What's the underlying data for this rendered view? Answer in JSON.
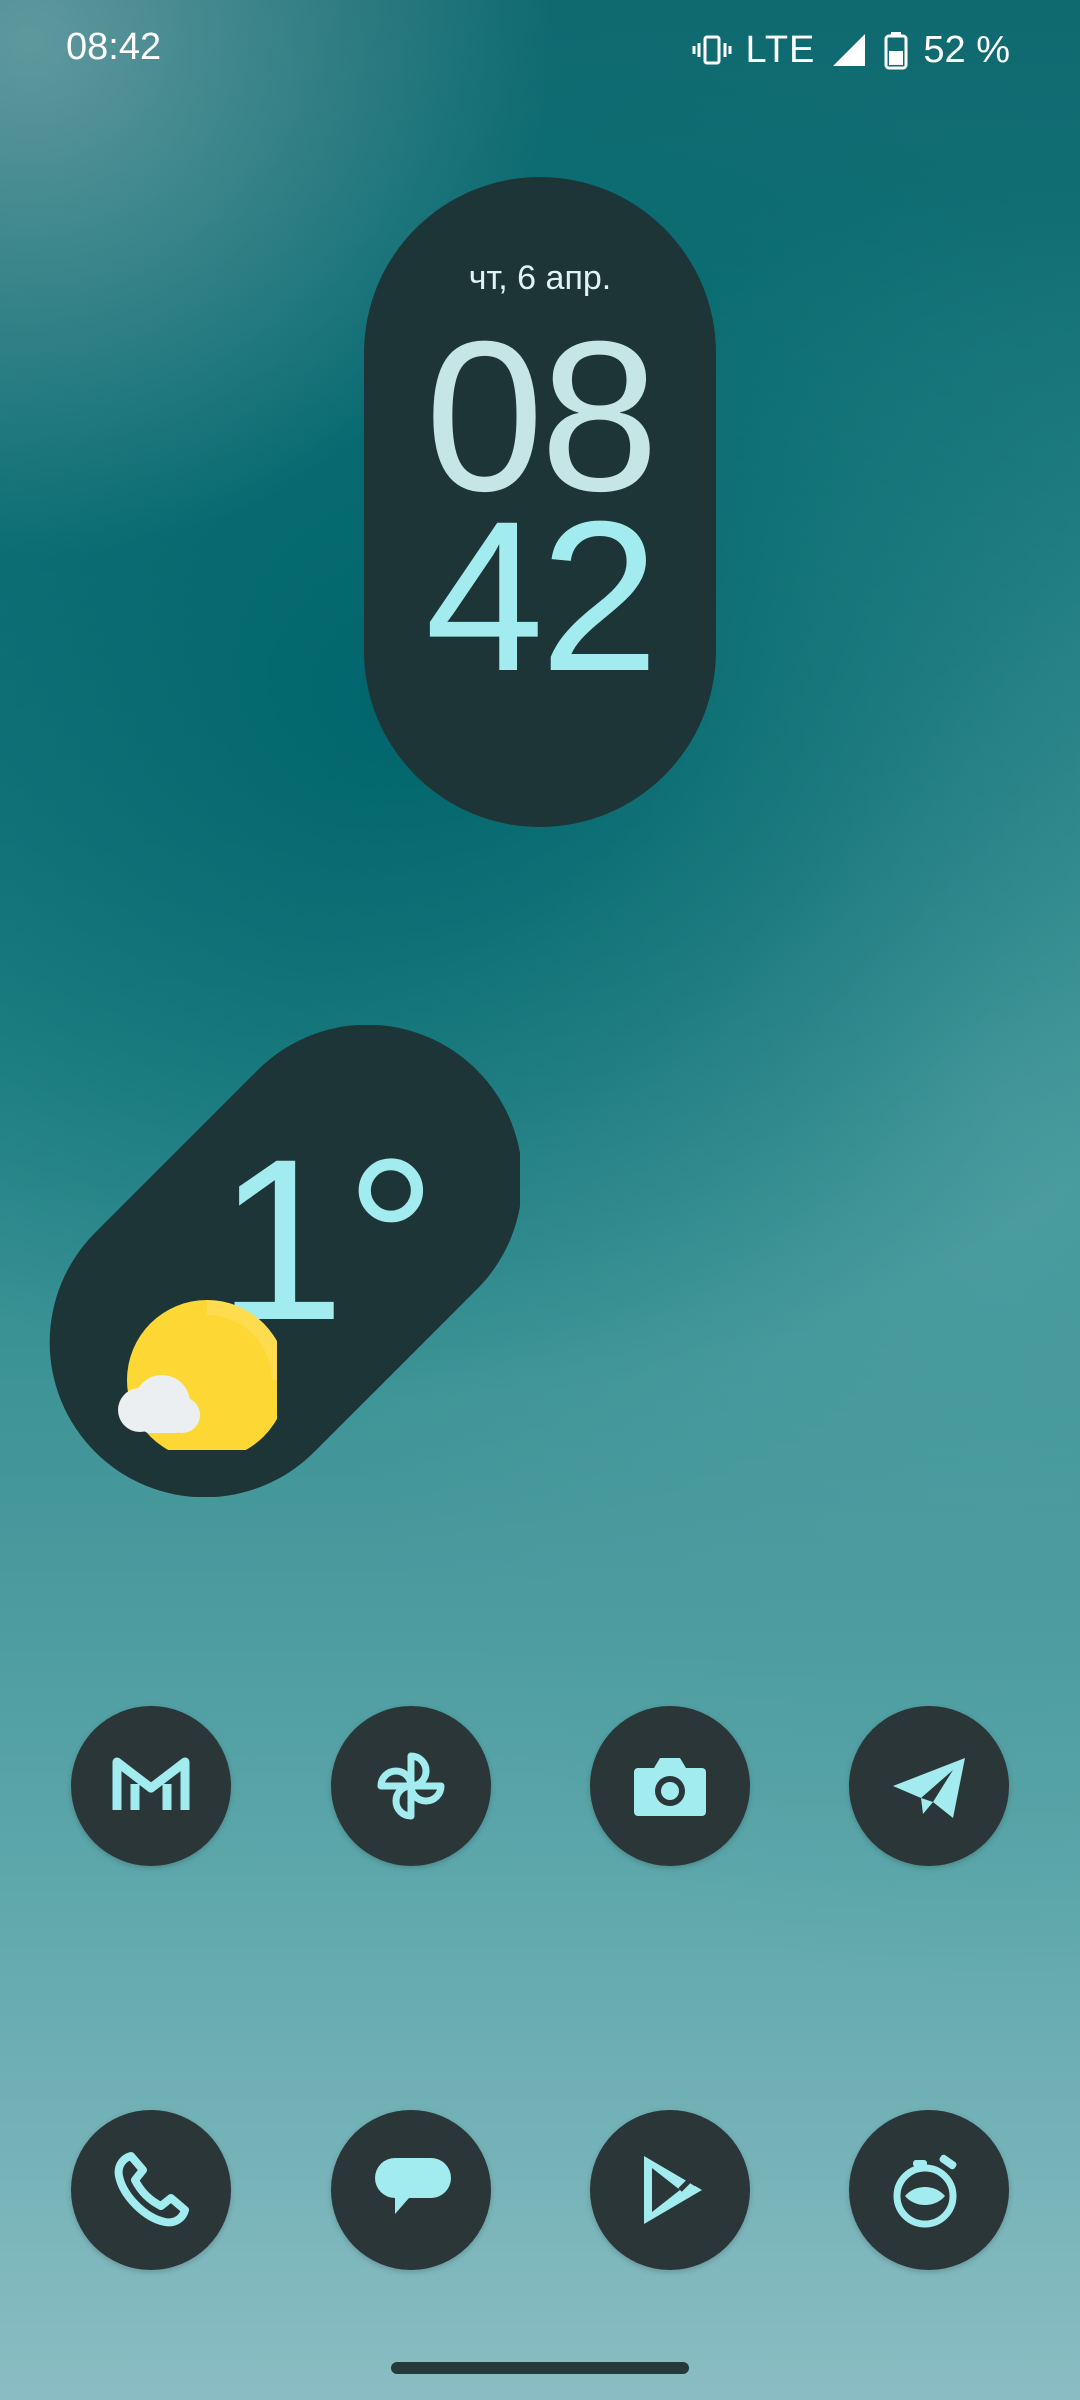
{
  "status_bar": {
    "time": "08:42",
    "network": "LTE",
    "battery": "52 %",
    "icons": [
      "vibrate-icon",
      "signal-icon",
      "battery-icon"
    ]
  },
  "clock_widget": {
    "date": "чт, 6 апр.",
    "hours": "08",
    "minutes": "42"
  },
  "weather_widget": {
    "temperature": "1°",
    "condition_icon": "sun-with-cloud-icon"
  },
  "apps_row1": [
    {
      "icon": "gmail-icon"
    },
    {
      "icon": "pinwheel-icon"
    },
    {
      "icon": "camera-icon"
    },
    {
      "icon": "telegram-icon"
    }
  ],
  "apps_row2": [
    {
      "icon": "phone-icon"
    },
    {
      "icon": "messages-icon"
    },
    {
      "icon": "play-store-icon"
    },
    {
      "icon": "timer-icon"
    }
  ],
  "colors": {
    "widget_bg": "#1e3538",
    "accent": "#a2ecef",
    "icon_bg": "#2b3638",
    "sun": "#fdd835"
  }
}
